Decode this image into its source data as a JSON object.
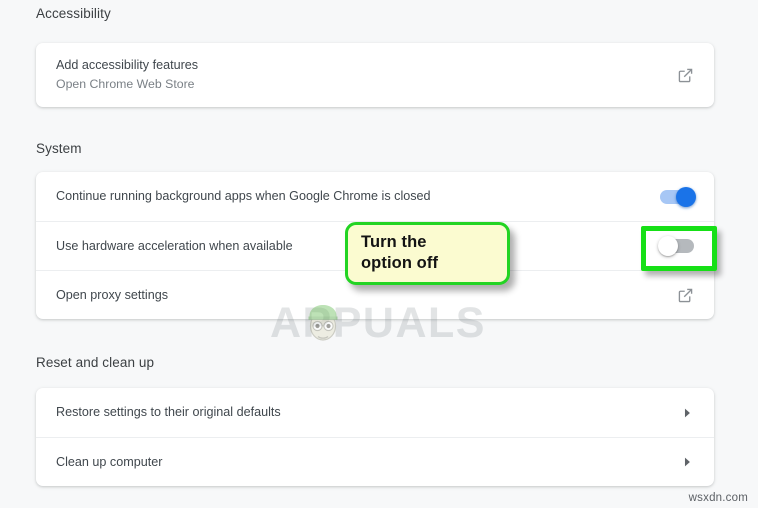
{
  "page": {
    "background_color": "#f7f8f9",
    "footer_credit": "wsxdn.com"
  },
  "sections": [
    {
      "id": "accessibility",
      "title": "Accessibility",
      "rows": [
        {
          "title": "Add accessibility features",
          "subtitle": "Open Chrome Web Store",
          "action": "external-link-icon"
        }
      ]
    },
    {
      "id": "system",
      "title": "System",
      "rows": [
        {
          "title": "Continue running background apps when Google Chrome is closed",
          "subtitle": "",
          "action": "toggle",
          "toggle_state": "on"
        },
        {
          "title": "Use hardware acceleration when available",
          "subtitle": "",
          "action": "toggle",
          "toggle_state": "off"
        },
        {
          "title": "Open proxy settings",
          "subtitle": "",
          "action": "external-link-icon"
        }
      ]
    },
    {
      "id": "reset-and-clean-up",
      "title": "Reset and clean up",
      "rows": [
        {
          "title": "Restore settings to their original defaults",
          "subtitle": "",
          "action": "chevron-right-icon"
        },
        {
          "title": "Clean up computer",
          "subtitle": "",
          "action": "chevron-right-icon"
        }
      ]
    }
  ],
  "annotations": {
    "callout": {
      "line1": "Turn the",
      "line2": "option off",
      "fill_color": "#fbfbd0",
      "border_color": "#23d423"
    },
    "highlight_box": {
      "border_color": "#16e016"
    }
  },
  "watermark": {
    "text_before": "A",
    "text_after": "PUALS",
    "full_text": "APPUALS"
  },
  "colors": {
    "toggle_on_track": "#a7c7f5",
    "toggle_on_knob": "#1a73e8",
    "toggle_off_track": "#b5b9bd",
    "toggle_off_knob": "#ffffff",
    "card_background": "#ffffff",
    "primary_text": "#40474d",
    "secondary_text": "#7a8086",
    "heading_text": "#3c4043"
  }
}
